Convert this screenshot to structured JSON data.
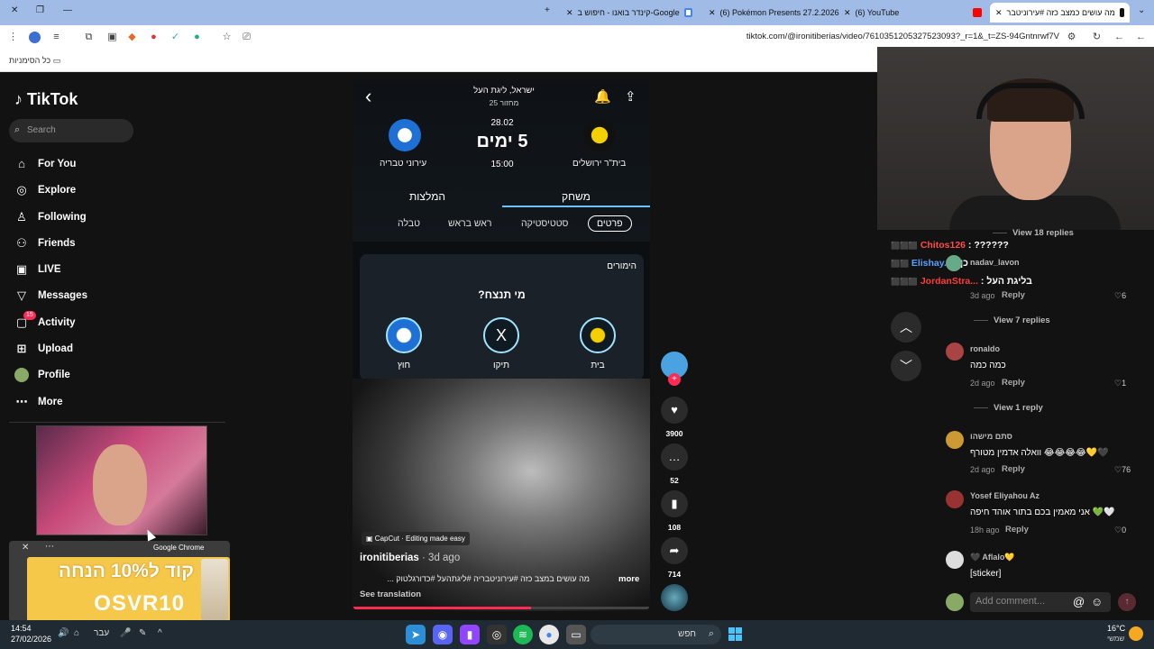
{
  "browser": {
    "tabs": [
      {
        "title": "מה עושים כמצב כזה #עירוניטבר",
        "active": true
      },
      {
        "title": "(6) YouTube"
      },
      {
        "title": "(6) Pokémon Presents 27.2.2026"
      },
      {
        "title": "קינדר בואנו - חיפוש ב-Google"
      }
    ],
    "url": "tiktok.com/@ironitiberias/video/7610351205327523093?_r=1&_t=ZS-94Gntnrwf7V",
    "bookmarks_label": "כל הסימניות"
  },
  "sidebar": {
    "logo": "TikTok",
    "search_placeholder": "Search",
    "items": [
      {
        "label": "For You",
        "icon": "home-icon"
      },
      {
        "label": "Explore",
        "icon": "compass-icon"
      },
      {
        "label": "Following",
        "icon": "following-icon"
      },
      {
        "label": "Friends",
        "icon": "friends-icon"
      },
      {
        "label": "LIVE",
        "icon": "live-icon"
      },
      {
        "label": "Messages",
        "icon": "messages-icon"
      },
      {
        "label": "Activity",
        "icon": "activity-icon"
      },
      {
        "label": "Upload",
        "icon": "upload-icon"
      },
      {
        "label": "Profile",
        "icon": "profile-avatar"
      },
      {
        "label": "More",
        "icon": "more-icon"
      }
    ],
    "activity_badge": "15"
  },
  "ad": {
    "source": "Google Chrome",
    "line1": "קוד ל10% הנחה",
    "line2": "OSVR10"
  },
  "video": {
    "league": "ישראל, ליגת העל",
    "round": "מחזור 25",
    "date": "28.02",
    "countdown": "5 ימים",
    "time": "15:00",
    "home_team": "בית\"ר ירושלים",
    "away_team": "עירוני טבריה",
    "tabs": [
      "משחק",
      "המלצות"
    ],
    "subtabs": [
      "פרטים",
      "סטטיסטיקה",
      "ראש בראש",
      "טבלה"
    ],
    "bet_header": "הימורים",
    "bet_question": "מי תנצח?",
    "bet_options": [
      "בית",
      "תיקו",
      "חוץ"
    ],
    "draw_symbol": "X",
    "capcut": "CapCut · Editing made easy",
    "author": "ironitiberias",
    "author_date": " · 3d ago",
    "caption": "מה עושים במצב כזה #עירוניטבריה #ליגתהעל #כדורגלטוק ...",
    "more": "more",
    "see_translation": "See translation",
    "progress": 0.6
  },
  "actions": {
    "likes": "3900",
    "comments": "52",
    "saves": "108",
    "shares": "714"
  },
  "twitch_chat": [
    {
      "user": "Chitos126",
      "msg": ": ??????",
      "color": "#ff4a4a"
    },
    {
      "user": "Elishay...",
      "msg": ": כן",
      "color": "#5aa0ff"
    },
    {
      "user": "JordanStra...",
      "msg": ": בליגת העל",
      "color": "#ff3a3a"
    }
  ],
  "comments": [
    {
      "user": "nadav_lavon",
      "text": "",
      "date": "3d ago",
      "likes": "6"
    },
    {
      "user": "ronaldo",
      "text": "כמה כמה",
      "date": "2d ago",
      "likes": "1"
    },
    {
      "user": "סתם מישהו",
      "text": "וואלה אדמין מטורף 😂😂😂😂💛🖤",
      "date": "2d ago",
      "likes": "76"
    },
    {
      "user": "Yosef Eliyahou Az",
      "text": "אני מאמין בכם בתור אוהד חיפה 💚🤍",
      "date": "18h ago",
      "likes": "0"
    },
    {
      "user": "🖤 Aflalo💛",
      "text": "[sticker]",
      "date": "",
      "likes": ""
    }
  ],
  "comment_ui": {
    "reply": "Reply",
    "view_top": "View 18 replies",
    "view_7": "View 7 replies",
    "view_1": "View 1 reply",
    "input_placeholder": "Add comment..."
  },
  "taskbar": {
    "time": "14:54",
    "date": "27/02/2026",
    "lang": "עבר",
    "search": "חפש",
    "weather_temp": "16°C",
    "weather_desc": "שמשי"
  }
}
